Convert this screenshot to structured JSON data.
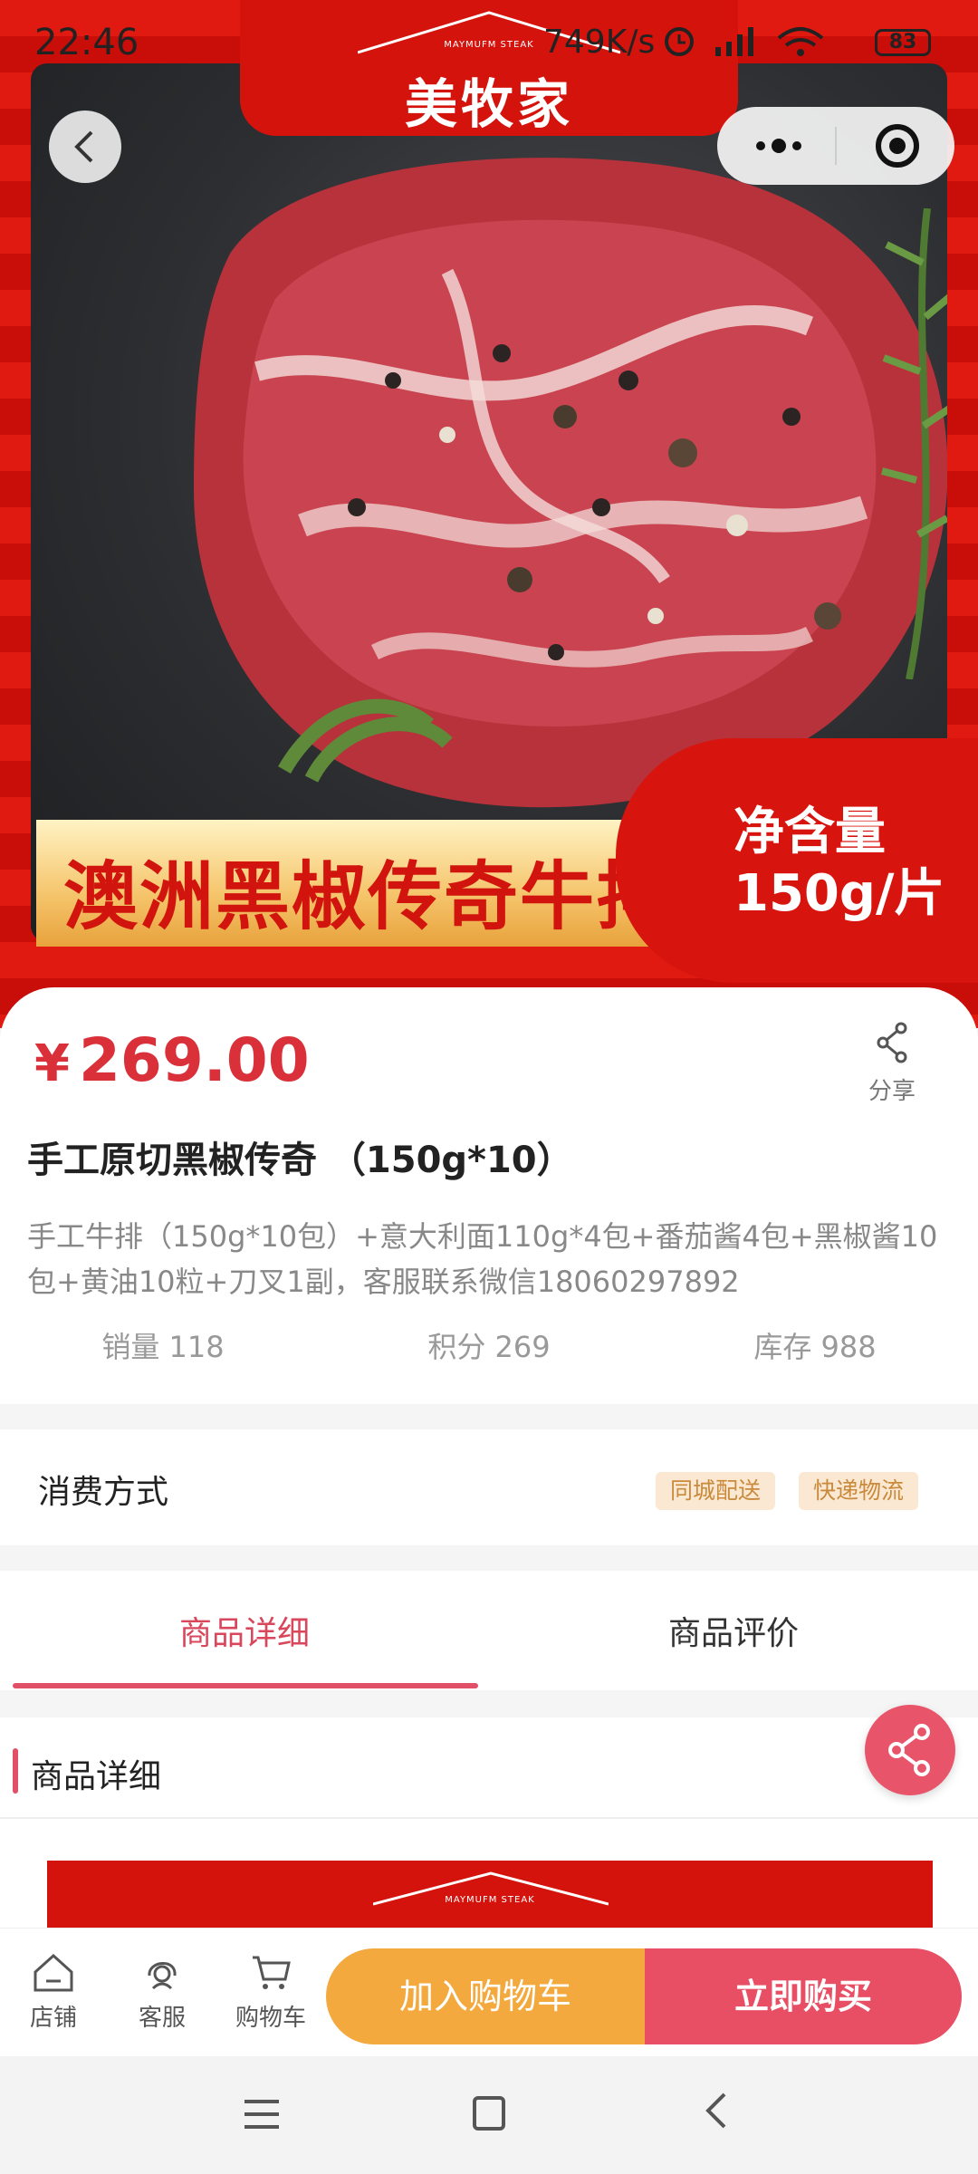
{
  "status_bar": {
    "time": "22:46",
    "network_speed": "749K/s",
    "battery": "83"
  },
  "hero": {
    "brand_name": "美牧家",
    "brand_sub": "MAYMUFM STEAK",
    "banner_title": "澳洲黑椒传奇牛排",
    "net_content_label": "净含量",
    "net_content_value": "150g/片"
  },
  "product": {
    "currency": "¥",
    "price": "269.00",
    "share_label": "分享",
    "title": "手工原切黑椒传奇  （150g*10）",
    "description": "手工牛排（150g*10包）+意大利面110g*4包+番茄酱4包+黑椒酱10包+黄油10粒+刀叉1副，客服联系微信18060297892",
    "stats": {
      "sales": "销量 118",
      "points": "积分 269",
      "stock": "库存 988"
    }
  },
  "consumption": {
    "label": "消费方式",
    "tags": [
      "同城配送",
      "快递物流"
    ]
  },
  "tabs": {
    "details": "商品详细",
    "reviews": "商品评价"
  },
  "detail_section": {
    "title": "商品详细",
    "image_brand_sub": "MAYMUFM STEAK"
  },
  "action_bar": {
    "store": "店铺",
    "service": "客服",
    "cart": "购物车",
    "add_to_cart": "加入购物车",
    "buy_now": "立即购买"
  },
  "colors": {
    "accent": "#e84f64",
    "price": "#d9303a",
    "cart_button": "#f3a93d",
    "brand_red": "#d4130d"
  }
}
